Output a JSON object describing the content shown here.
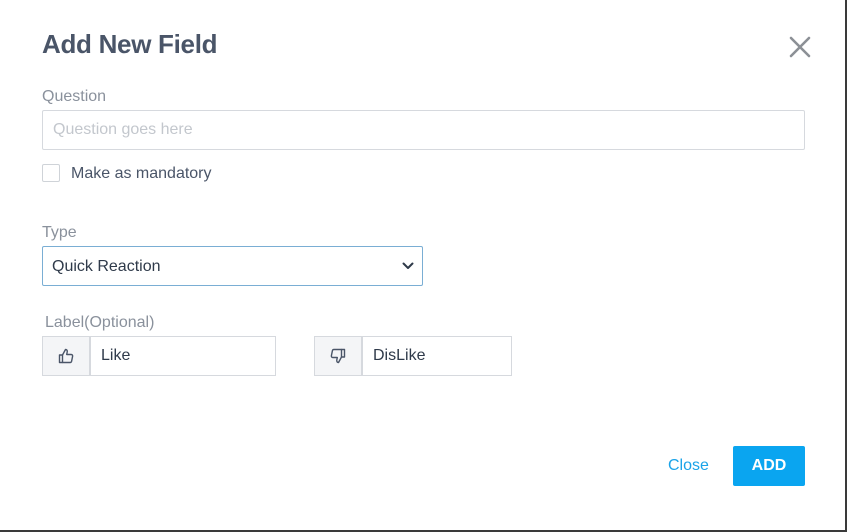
{
  "dialog": {
    "title": "Add New Field",
    "close_icon": "close-icon"
  },
  "question": {
    "label": "Question",
    "value": "",
    "placeholder": "Question goes here"
  },
  "mandatory": {
    "label": "Make as mandatory",
    "checked": false
  },
  "type": {
    "label": "Type",
    "selected": "Quick Reaction",
    "icon": "chevron-down-icon"
  },
  "reaction_labels": {
    "label": "Label(Optional)",
    "like": {
      "icon": "thumbs-up-icon",
      "value": "Like"
    },
    "dislike": {
      "icon": "thumbs-down-icon",
      "value": "DisLike"
    }
  },
  "footer": {
    "close_label": "Close",
    "add_label": "ADD"
  },
  "colors": {
    "primary": "#0aa5f0",
    "link": "#1aa3e8",
    "title": "#4a5568",
    "focus_border": "#7aaed4"
  }
}
